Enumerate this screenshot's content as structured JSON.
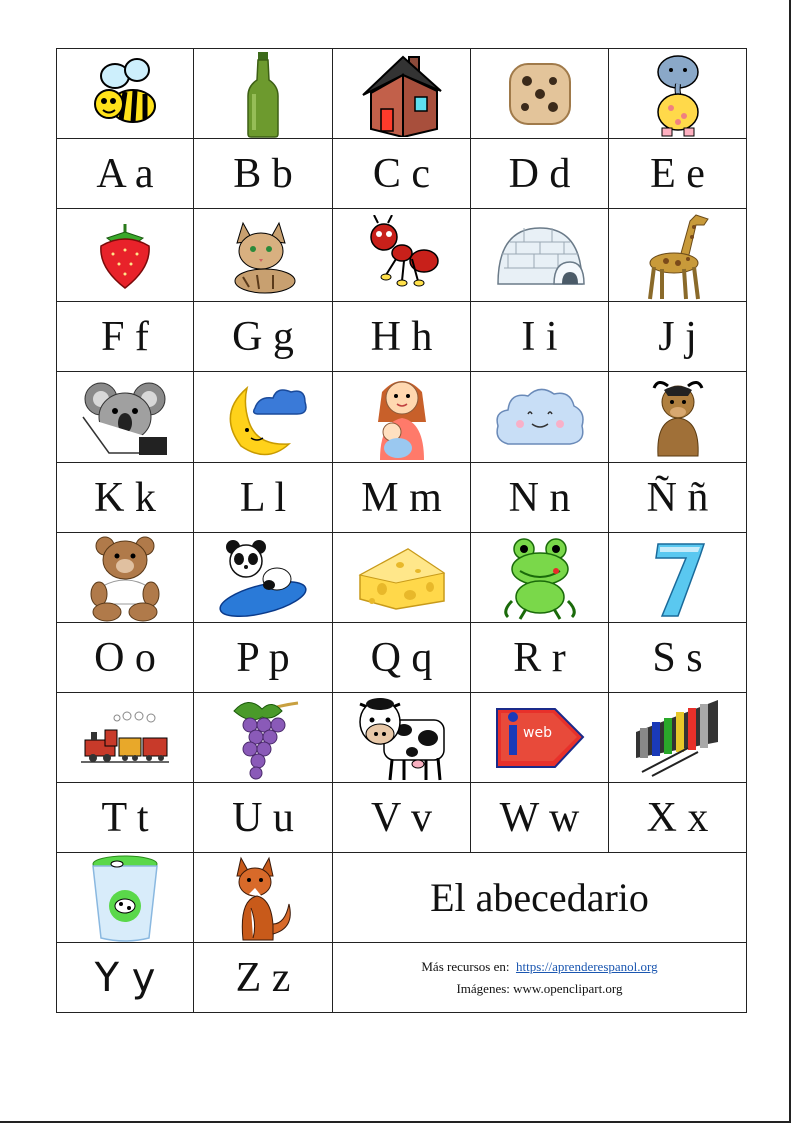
{
  "rows": [
    {
      "letters": [
        "A a",
        "B b",
        "C c",
        "D d",
        "E e"
      ],
      "icons": [
        "bee-icon",
        "bottle-icon",
        "house-icon",
        "dice-icon",
        "elephant-icon"
      ]
    },
    {
      "letters": [
        "F f",
        "G g",
        "H h",
        "I i",
        "J j"
      ],
      "icons": [
        "strawberry-icon",
        "cat-icon",
        "ant-icon",
        "igloo-icon",
        "giraffe-icon"
      ]
    },
    {
      "letters": [
        "K k",
        "L l",
        "M m",
        "N n",
        "Ñ ñ"
      ],
      "icons": [
        "koala-icon",
        "moon-icon",
        "mother-icon",
        "cloud-icon",
        "yak-icon"
      ]
    },
    {
      "letters": [
        "O o",
        "P p",
        "Q q",
        "R r",
        "S s"
      ],
      "icons": [
        "bear-icon",
        "panda-icon",
        "cheese-icon",
        "frog-icon",
        "seven-icon"
      ]
    },
    {
      "letters": [
        "T t",
        "U u",
        "V v",
        "W w",
        "X x"
      ],
      "icons": [
        "train-icon",
        "grapes-icon",
        "cow-icon",
        "web-icon",
        "xylophone-icon"
      ]
    },
    {
      "letters": [
        "Y y",
        "Z z"
      ],
      "icons": [
        "yogurt-icon",
        "fox-icon"
      ]
    }
  ],
  "title": "El abecedario",
  "credits": {
    "more_label": "Más recursos  en:",
    "more_link": "https://aprenderespanol.org",
    "images_label": "Imágenes: www.openclipart.org"
  },
  "colors": {
    "border": "#222222",
    "link": "#1a56b0"
  }
}
